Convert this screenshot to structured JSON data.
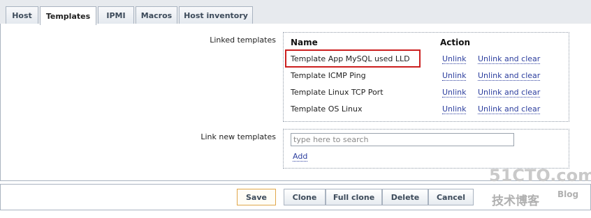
{
  "tabs": [
    {
      "label": "Host",
      "active": false
    },
    {
      "label": "Templates",
      "active": true
    },
    {
      "label": "IPMI",
      "active": false
    },
    {
      "label": "Macros",
      "active": false
    },
    {
      "label": "Host inventory",
      "active": false
    }
  ],
  "linked_templates": {
    "label": "Linked templates",
    "col_name": "Name",
    "col_action": "Action",
    "rows": [
      {
        "name": "Template App MySQL used LLD",
        "unlink": "Unlink",
        "unlink_clear": "Unlink and clear",
        "highlighted": true
      },
      {
        "name": "Template ICMP Ping",
        "unlink": "Unlink",
        "unlink_clear": "Unlink and clear",
        "highlighted": false
      },
      {
        "name": "Template Linux TCP Port",
        "unlink": "Unlink",
        "unlink_clear": "Unlink and clear",
        "highlighted": false
      },
      {
        "name": "Template OS Linux",
        "unlink": "Unlink",
        "unlink_clear": "Unlink and clear",
        "highlighted": false
      }
    ],
    "highlight_color": "#cc1f1f"
  },
  "link_new": {
    "label": "Link new templates",
    "search_placeholder": "type here to search",
    "search_value": "",
    "add_label": "Add"
  },
  "footer": {
    "save": "Save",
    "clone": "Clone",
    "full_clone": "Full clone",
    "delete": "Delete",
    "cancel": "Cancel"
  },
  "watermark": {
    "main": "51CTO.com",
    "sub": "技术博客",
    "blog": "Blog"
  },
  "colors": {
    "link": "#2c3e9e",
    "border": "#a9b3c0",
    "save_border": "#e0a64a"
  }
}
